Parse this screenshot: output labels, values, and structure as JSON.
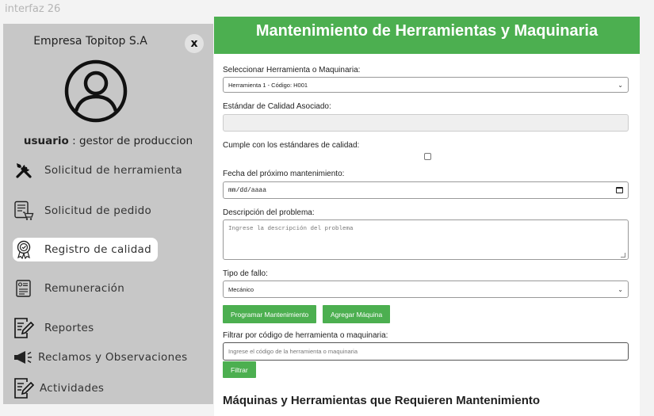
{
  "window": {
    "title": "interfaz 26"
  },
  "sidebar": {
    "company": "Empresa Topitop S.A",
    "close_label": "x",
    "user_label": "usuario",
    "user_role": " : gestor de produccion",
    "items": [
      {
        "label": "Solicitud de herramienta",
        "icon": "tools-icon"
      },
      {
        "label": "Solicitud de pedido",
        "icon": "order-cart-icon"
      },
      {
        "label": "Registro de calidad",
        "icon": "quality-badge-icon"
      },
      {
        "label": "Remuneración",
        "icon": "payment-document-icon"
      },
      {
        "label": "Reportes",
        "icon": "report-edit-icon"
      },
      {
        "label": "Reclamos y Observaciones",
        "icon": "megaphone-icon"
      },
      {
        "label": "Actividades",
        "icon": "activity-edit-icon"
      }
    ],
    "active_index": 2
  },
  "main": {
    "title": "Mantenimiento de Herramientas y Maquinaria",
    "tool_select_label": "Seleccionar Herramienta o Maquinaria:",
    "tool_select_value": "Herramienta 1 - Código: H001",
    "standard_label": "Estándar de Calidad Asociado:",
    "standard_value": "",
    "complies_label": "Cumple con los estándares de calidad:",
    "complies_checked": false,
    "date_label": "Fecha del próximo mantenimiento:",
    "date_value": "mm/dd/aaaa",
    "description_label": "Descripción del problema:",
    "description_placeholder": "Ingrese la descripción del problema",
    "failure_label": "Tipo de fallo:",
    "failure_value": "Mecánico",
    "schedule_button": "Programar Mantenimiento",
    "add_machine_button": "Agregar Máquina",
    "filter_label": "Filtrar por código de herramienta o maquinaria:",
    "filter_placeholder": "Ingrese el código de la herramienta o maquinaria",
    "filter_button": "Filtrar",
    "section_title": "Máquinas y Herramientas que Requieren Mantenimiento"
  },
  "colors": {
    "accent": "#4caf50",
    "sidebar_bg": "#c7c7c7"
  }
}
